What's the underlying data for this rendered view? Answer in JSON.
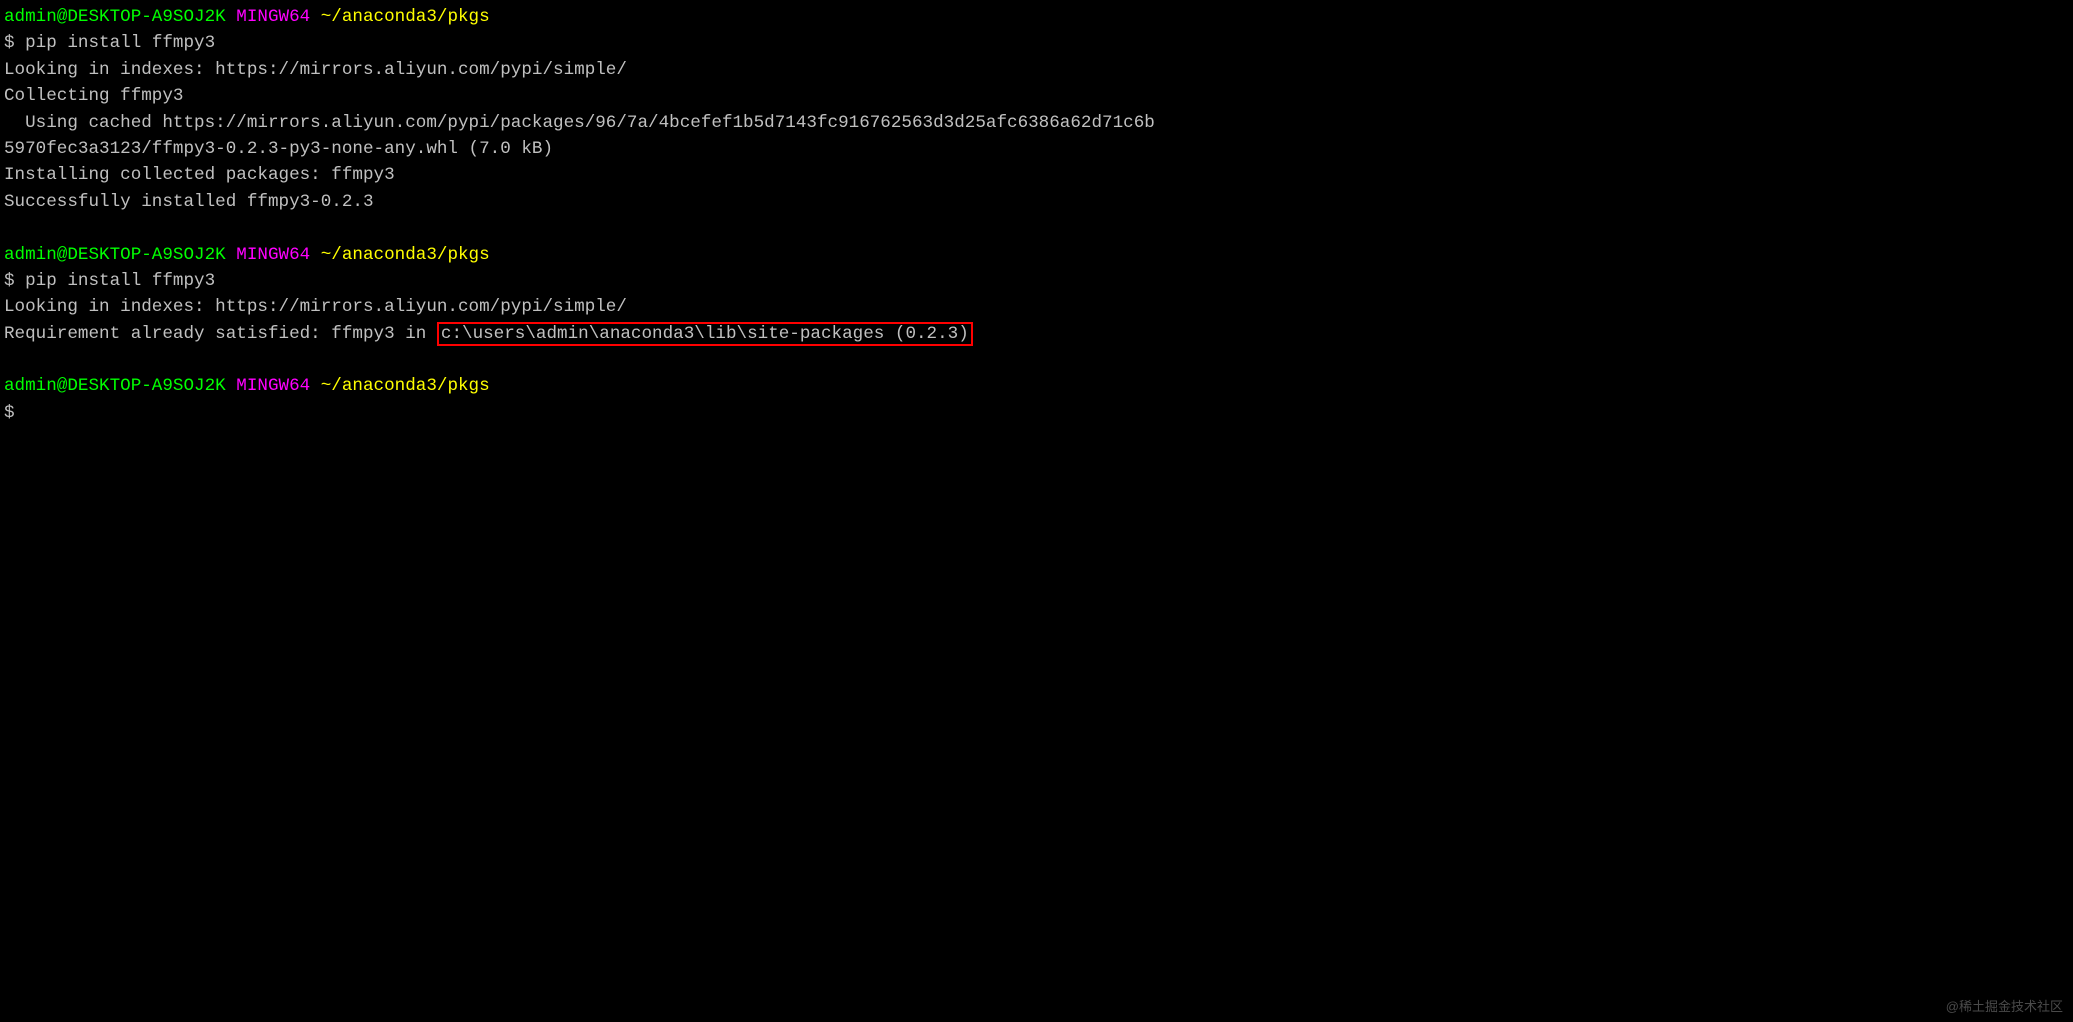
{
  "prompt1": {
    "user_host": "admin@DESKTOP-A9SOJ2K",
    "shell": "MINGW64",
    "path": "~/anaconda3/pkgs",
    "symbol": "$ ",
    "command": "pip install ffmpy3"
  },
  "output1": {
    "line1": "Looking in indexes: https://mirrors.aliyun.com/pypi/simple/",
    "line2": "Collecting ffmpy3",
    "line3": "  Using cached https://mirrors.aliyun.com/pypi/packages/96/7a/4bcefef1b5d7143fc916762563d3d25afc6386a62d71c6b",
    "line4": "5970fec3a3123/ffmpy3-0.2.3-py3-none-any.whl (7.0 kB)",
    "line5": "Installing collected packages: ffmpy3",
    "line6": "Successfully installed ffmpy3-0.2.3"
  },
  "prompt2": {
    "user_host": "admin@DESKTOP-A9SOJ2K",
    "shell": "MINGW64",
    "path": "~/anaconda3/pkgs",
    "symbol": "$ ",
    "command": "pip install ffmpy3"
  },
  "output2": {
    "line1": "Looking in indexes: https://mirrors.aliyun.com/pypi/simple/",
    "line2_prefix": "Requirement already satisfied: ffmpy3 in ",
    "line2_highlight": "c:\\users\\admin\\anaconda3\\lib\\site-packages (0.2.3)"
  },
  "prompt3": {
    "user_host": "admin@DESKTOP-A9SOJ2K",
    "shell": "MINGW64",
    "path": "~/anaconda3/pkgs",
    "symbol": "$"
  },
  "watermark": "@稀土掘金技术社区"
}
